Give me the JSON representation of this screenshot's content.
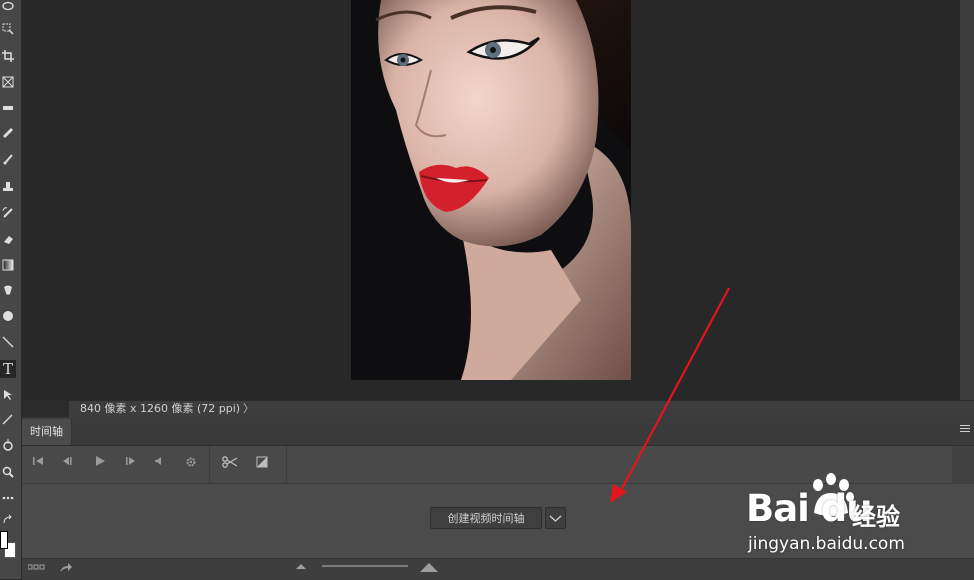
{
  "toolbar": {
    "tools": [
      "lasso-tool",
      "quick-select-tool",
      "crop-tool",
      "frame-tool",
      "ruler-tool",
      "healing-brush-tool",
      "brush-tool",
      "clone-stamp-tool",
      "history-brush-tool",
      "eraser-tool",
      "gradient-tool",
      "smudge-tool",
      "dodge-tool",
      "line-tool",
      "type-tool",
      "path-selection-tool",
      "pen-tool",
      "rotate-view-tool",
      "zoom-tool",
      "more-tools"
    ],
    "type_tool_glyph": "T",
    "foreground_color": "#ffffff",
    "background_color": "#ffffff"
  },
  "document": {
    "info": "840 像素 x 1260 像素 (72 ppi)",
    "info_arrow": "〉"
  },
  "timeline_panel": {
    "tab_label": "时间轴",
    "create_button_label": "创建视频时间轴"
  },
  "watermark": {
    "logo_text": "Bai du",
    "jingyan_text": "经验",
    "url": "jingyan.baidu.com"
  },
  "colors": {
    "annotation_arrow": "#e0161b",
    "lipstick": "#d4202c"
  }
}
